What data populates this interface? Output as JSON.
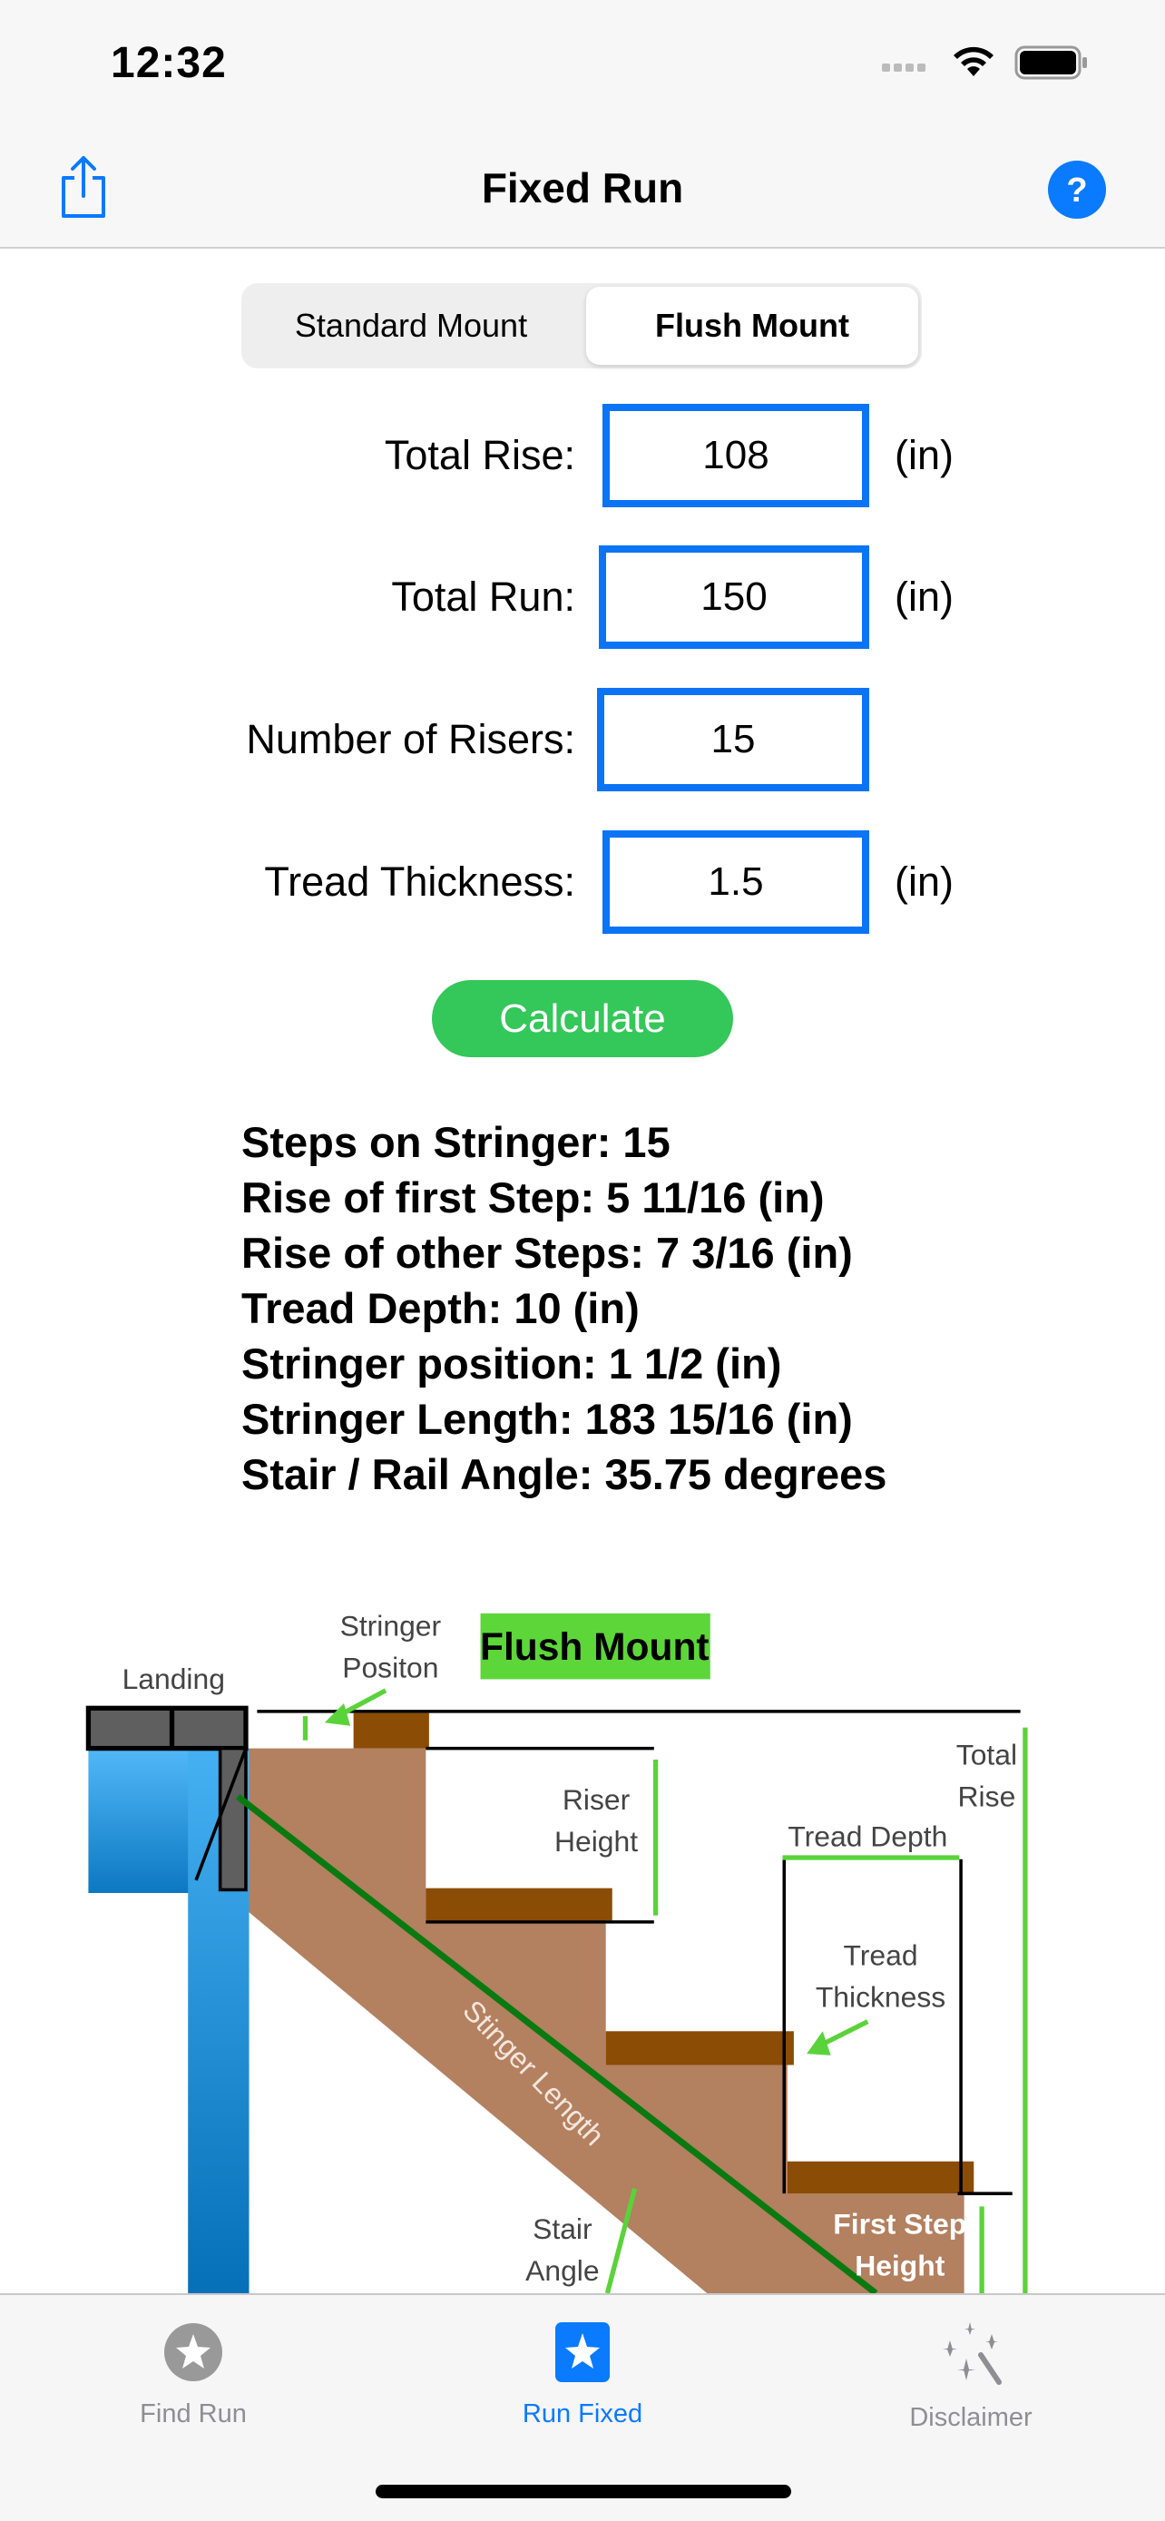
{
  "status": {
    "time": "12:32"
  },
  "nav": {
    "title": "Fixed Run",
    "share_icon": "share-icon",
    "help_icon": "question-circle-icon",
    "accent": "#0a7aff"
  },
  "segments": {
    "options": [
      "Standard Mount",
      "Flush Mount"
    ],
    "selected": "Flush Mount"
  },
  "form": {
    "total_rise": {
      "label": "Total Rise:",
      "value": "108",
      "unit": "(in)"
    },
    "total_run": {
      "label": "Total Run:",
      "value": "150",
      "unit": "(in)"
    },
    "risers": {
      "label": "Number of Risers:",
      "value": "15"
    },
    "tread_thickness": {
      "label": "Tread Thickness:",
      "value": "1.5",
      "unit": "(in)"
    },
    "calculate": "Calculate"
  },
  "results": [
    "Steps on Stringer: 15",
    "Rise of first Step: 5 11/16 (in)",
    "Rise of other Steps: 7 3/16 (in)",
    "Tread Depth: 10 (in)",
    "Stringer position: 1 1/2 (in)",
    "Stringer Length: 183 15/16 (in)",
    "Stair / Rail Angle: 35.75 degrees"
  ],
  "diagram": {
    "badge": "Flush Mount",
    "landing": "Landing",
    "stringer_position": [
      "Stringer",
      "Positon"
    ],
    "riser_height": [
      "Riser",
      "Height"
    ],
    "total_rise": [
      "Total",
      "Rise"
    ],
    "tread_depth": "Tread Depth",
    "tread_thickness": [
      "Tread",
      "Thickness"
    ],
    "stringer_length": "Stinger Length",
    "stair_angle": [
      "Stair",
      "Angle"
    ],
    "first_step_height": [
      "First Step",
      "Height"
    ]
  },
  "tabs": [
    {
      "label": "Find Run",
      "icon": "star-circle-icon",
      "active": false
    },
    {
      "label": "Run Fixed",
      "icon": "star-square-icon",
      "active": true
    },
    {
      "label": "Disclaimer",
      "icon": "magic-wand-icon",
      "active": false
    }
  ]
}
